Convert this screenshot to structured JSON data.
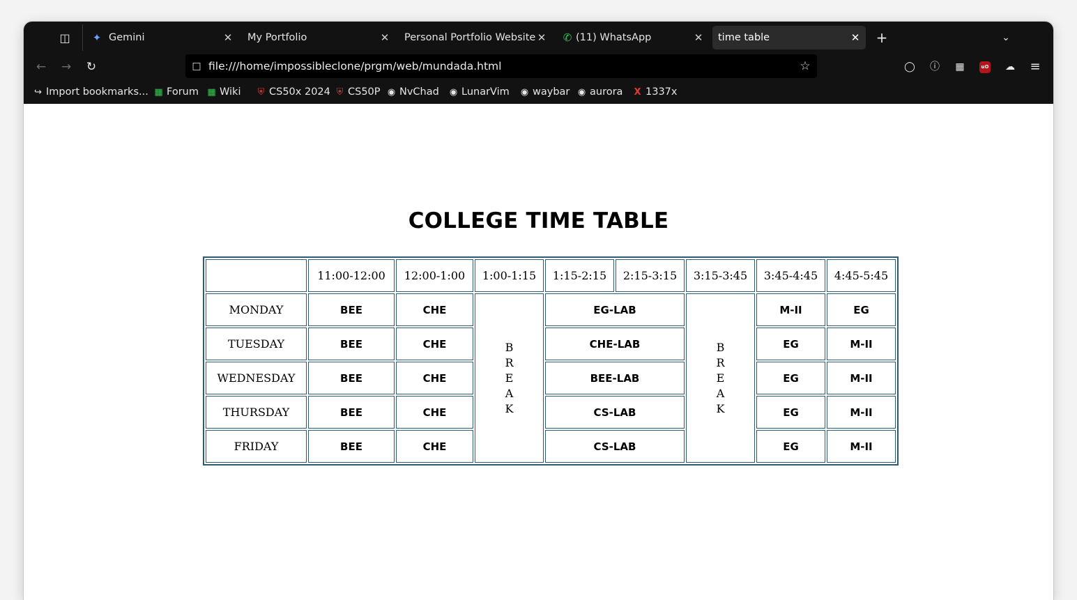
{
  "browser": {
    "tabs": [
      {
        "title": "Gemini",
        "icon": "gemini-sparkle-icon",
        "active": false
      },
      {
        "title": "My Portfolio",
        "icon": "",
        "active": false
      },
      {
        "title": "Personal Portfolio Website",
        "icon": "",
        "active": false
      },
      {
        "title": "(11) WhatsApp",
        "icon": "whatsapp-icon",
        "active": false
      },
      {
        "title": "time table",
        "icon": "",
        "active": true
      }
    ],
    "url": "file:///home/impossibleclone/prgm/web/mundada.html",
    "bookmarks": [
      {
        "label": "Import bookmarks...",
        "icon": "import-icon"
      },
      {
        "label": "Forum",
        "icon": "manjaro-icon"
      },
      {
        "label": "Wiki",
        "icon": "manjaro-icon"
      },
      {
        "label": "CS50x 2024",
        "icon": "harvard-shield-icon"
      },
      {
        "label": "CS50P",
        "icon": "harvard-shield-icon"
      },
      {
        "label": "NvChad",
        "icon": "github-icon"
      },
      {
        "label": "LunarVim",
        "icon": "github-icon"
      },
      {
        "label": "waybar",
        "icon": "github-icon"
      },
      {
        "label": "aurora",
        "icon": "github-icon"
      },
      {
        "label": "1337x",
        "icon": "1337x-icon"
      }
    ],
    "colors": {
      "chrome": "#121212",
      "active_tab": "#2b2b2b",
      "table_border": "#2c5a73"
    }
  },
  "page": {
    "title": "COLLEGE TIME TABLE",
    "header": [
      "",
      "11:00-12:00",
      "12:00-1:00",
      "1:00-1:15",
      "1:15-2:15",
      "2:15-3:15",
      "3:15-3:45",
      "3:45-4:45",
      "4:45-5:45"
    ],
    "break_letters": [
      "B",
      "R",
      "E",
      "A",
      "K"
    ],
    "rows": [
      {
        "day": "MONDAY",
        "s1": "BEE",
        "s2": "CHE",
        "lab": "EG-LAB",
        "s3": "M-II",
        "s4": "EG"
      },
      {
        "day": "TUESDAY",
        "s1": "BEE",
        "s2": "CHE",
        "lab": "CHE-LAB",
        "s3": "EG",
        "s4": "M-II"
      },
      {
        "day": "WEDNESDAY",
        "s1": "BEE",
        "s2": "CHE",
        "lab": "BEE-LAB",
        "s3": "EG",
        "s4": "M-II"
      },
      {
        "day": "THURSDAY",
        "s1": "BEE",
        "s2": "CHE",
        "lab": "CS-LAB",
        "s3": "EG",
        "s4": "M-II"
      },
      {
        "day": "FRIDAY",
        "s1": "BEE",
        "s2": "CHE",
        "lab": "CS-LAB",
        "s3": "EG",
        "s4": "M-II"
      }
    ]
  }
}
